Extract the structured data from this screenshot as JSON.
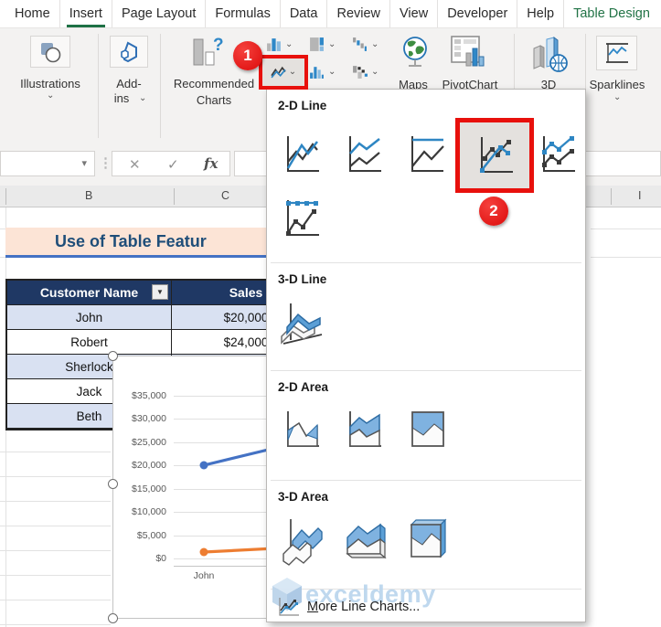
{
  "tabs": [
    {
      "label": "Home"
    },
    {
      "label": "Insert",
      "active": true
    },
    {
      "label": "Page Layout"
    },
    {
      "label": "Formulas"
    },
    {
      "label": "Data"
    },
    {
      "label": "Review"
    },
    {
      "label": "View"
    },
    {
      "label": "Developer"
    },
    {
      "label": "Help"
    },
    {
      "label": "Table Design",
      "accent": true
    }
  ],
  "ribbon": {
    "illustrations": "Illustrations",
    "addins_line1": "Add-",
    "addins_line2": "ins",
    "recommended_line1": "Recommended",
    "recommended_line2": "Charts",
    "maps": "Maps",
    "pivotchart": "PivotChart",
    "three_d": "3D",
    "sparklines": "Sparklines",
    "chevron": "⌄"
  },
  "formula_bar": {
    "name_box_value": "",
    "name_box_arrow": "▾",
    "dots": "⋮",
    "cancel": "✕",
    "confirm": "✓",
    "fx": "fx",
    "input_value": ""
  },
  "column_headers": {
    "b": "B",
    "c": "C",
    "i": "I"
  },
  "sheet": {
    "title": "Use of Table Featur",
    "table": {
      "headers": [
        "Customer Name",
        "Sales"
      ],
      "filter_arrow": "▼",
      "rows": [
        [
          "John",
          "$20,000"
        ],
        [
          "Robert",
          "$24,000"
        ],
        [
          "Sherlock",
          ""
        ],
        [
          "Jack",
          ""
        ],
        [
          "Beth",
          ""
        ]
      ]
    }
  },
  "chart_data": {
    "type": "line",
    "title": "",
    "xlabel": "",
    "ylabel": "",
    "visible_categories": [
      "John"
    ],
    "yticks": [
      "$35,000",
      "$30,000",
      "$25,000",
      "$20,000",
      "$15,000",
      "$10,000",
      "$5,000",
      "$0"
    ],
    "ylim": [
      0,
      35000
    ],
    "grid": true,
    "legend": "none visible",
    "series": [
      {
        "name": "series-blue",
        "color": "#4472c4",
        "points": [
          {
            "x": "John",
            "y": 20000
          }
        ],
        "trend": "rising toward right, continues under open menu"
      },
      {
        "name": "series-orange",
        "color": "#ed7d31",
        "points": [
          {
            "x": "John",
            "y": 1500
          }
        ],
        "trend": "nearly flat, continues under open menu"
      }
    ]
  },
  "chart_menu": {
    "sections": [
      {
        "title": "2-D Line",
        "items": [
          "line",
          "stacked-line",
          "100%-stacked-line",
          "line-with-markers",
          "stacked-line-with-markers",
          "100%-stacked-line-with-markers"
        ],
        "selected_item": "line-with-markers"
      },
      {
        "title": "3-D Line",
        "items": [
          "3d-line"
        ]
      },
      {
        "title": "2-D Area",
        "items": [
          "area",
          "stacked-area",
          "100%-stacked-area"
        ]
      },
      {
        "title": "3-D Area",
        "items": [
          "3d-area",
          "3d-stacked-area",
          "3d-100%-stacked-area"
        ]
      }
    ],
    "footer": "More Line Charts...",
    "watermark": "exceldemy"
  },
  "annotations": {
    "step1": "1",
    "step2": "2"
  },
  "colors": {
    "accent_green": "#217346",
    "annotation_red": "#e8100c",
    "table_header": "#1f3864",
    "band_row": "#d9e1f2",
    "title_bg": "#fce4d6",
    "title_text": "#1f4e79",
    "series_blue": "#4472c4",
    "series_orange": "#ed7d31"
  }
}
